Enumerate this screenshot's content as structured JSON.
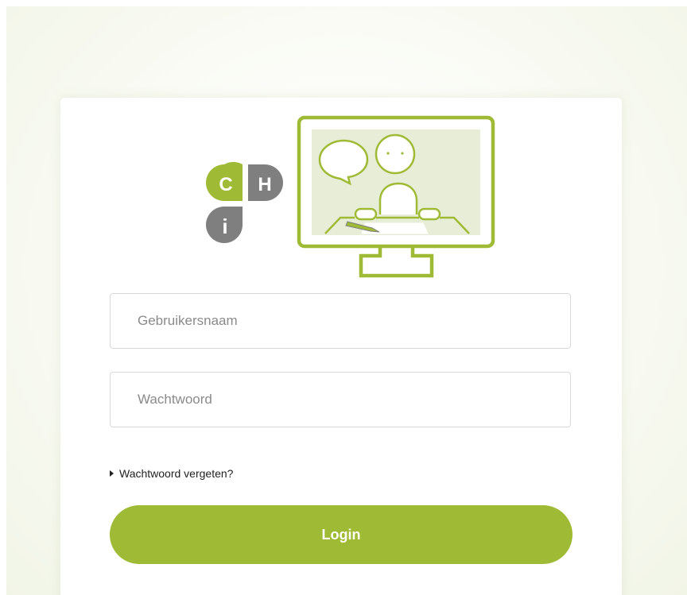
{
  "logo": {
    "letter_c": "C",
    "letter_h": "H",
    "letter_i": "i",
    "icon": "monitor-video-call-icon"
  },
  "form": {
    "username_placeholder": "Gebruikersnaam",
    "password_placeholder": "Wachtwoord",
    "forgot_label": "Wachtwoord vergeten?",
    "login_label": "Login"
  },
  "colors": {
    "brand_green": "#9fba34",
    "logo_gray": "#7f7f7f",
    "screen_fill": "#e8edd7"
  }
}
